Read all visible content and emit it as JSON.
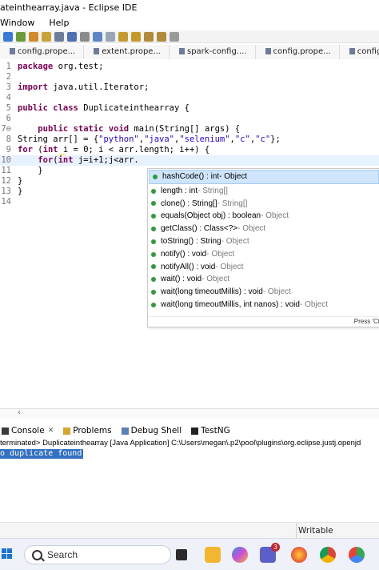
{
  "window": {
    "title": "ateinthearray.java - Eclipse IDE"
  },
  "menu": [
    "Window",
    "Help"
  ],
  "editor_tabs": [
    "config.prope...",
    "extent.prope...",
    "spark-config....",
    "config.prope...",
    "config.prope..."
  ],
  "code_lines": [
    {
      "num": "1",
      "segments": [
        {
          "t": "package",
          "c": "kw"
        },
        {
          "t": " org.test;",
          "c": ""
        }
      ]
    },
    {
      "num": "2",
      "segments": []
    },
    {
      "num": "3",
      "segments": [
        {
          "t": "import",
          "c": "kw"
        },
        {
          "t": " java.util.Iterator;",
          "c": ""
        }
      ]
    },
    {
      "num": "4",
      "segments": []
    },
    {
      "num": "5",
      "segments": [
        {
          "t": "public",
          "c": "kw"
        },
        {
          "t": " ",
          "c": ""
        },
        {
          "t": "class",
          "c": "kw"
        },
        {
          "t": " Duplicateinthearray {",
          "c": ""
        }
      ]
    },
    {
      "num": "6",
      "segments": []
    },
    {
      "num": "7⊖",
      "segments": [
        {
          "t": "    ",
          "c": ""
        },
        {
          "t": "public",
          "c": "kw"
        },
        {
          "t": " ",
          "c": ""
        },
        {
          "t": "static",
          "c": "kw"
        },
        {
          "t": " ",
          "c": ""
        },
        {
          "t": "void",
          "c": "kw"
        },
        {
          "t": " main(String[] args) {",
          "c": ""
        }
      ]
    },
    {
      "num": "8",
      "segments": [
        {
          "t": "String arr[] = {",
          "c": ""
        },
        {
          "t": "\"python\"",
          "c": "str"
        },
        {
          "t": ",",
          "c": ""
        },
        {
          "t": "\"java\"",
          "c": "str"
        },
        {
          "t": ",",
          "c": ""
        },
        {
          "t": "\"selenium\"",
          "c": "str"
        },
        {
          "t": ",",
          "c": ""
        },
        {
          "t": "\"c\"",
          "c": "str"
        },
        {
          "t": ",",
          "c": ""
        },
        {
          "t": "\"c\"",
          "c": "str"
        },
        {
          "t": "};",
          "c": ""
        }
      ]
    },
    {
      "num": "9",
      "segments": [
        {
          "t": "for",
          "c": "kw"
        },
        {
          "t": " (",
          "c": ""
        },
        {
          "t": "int",
          "c": "kw"
        },
        {
          "t": " i = 0; i < arr.length; i++) {",
          "c": ""
        }
      ]
    },
    {
      "num": "10",
      "segments": [
        {
          "t": "    ",
          "c": ""
        },
        {
          "t": "for",
          "c": "kw"
        },
        {
          "t": "(",
          "c": ""
        },
        {
          "t": "int",
          "c": "kw"
        },
        {
          "t": " j=i+1;j<arr.",
          "c": ""
        }
      ]
    },
    {
      "num": "11",
      "segments": [
        {
          "t": "    }",
          "c": ""
        }
      ]
    },
    {
      "num": "12",
      "segments": [
        {
          "t": "}",
          "c": ""
        }
      ]
    },
    {
      "num": "13",
      "segments": [
        {
          "t": "}",
          "c": ""
        }
      ]
    },
    {
      "num": "14",
      "segments": []
    }
  ],
  "autocomplete": {
    "items": [
      {
        "sig": "hashCode() : int",
        "type": " - Object"
      },
      {
        "sig": "length : int",
        "type": " - String[]"
      },
      {
        "sig": "clone() : String[]",
        "type": " - String[]"
      },
      {
        "sig": "equals(Object obj) : boolean",
        "type": " - Object"
      },
      {
        "sig": "getClass() : Class<?>",
        "type": " - Object"
      },
      {
        "sig": "toString() : String",
        "type": " - Object"
      },
      {
        "sig": "notify() : void",
        "type": " - Object"
      },
      {
        "sig": "notifyAll() : void",
        "type": " - Object"
      },
      {
        "sig": "wait() : void",
        "type": " - Object"
      },
      {
        "sig": "wait(long timeoutMillis) : void",
        "type": " - Object"
      },
      {
        "sig": "wait(long timeoutMillis, int nanos) : void",
        "type": " - Object"
      }
    ],
    "footer": "Press 'Ct"
  },
  "console_tabs": [
    {
      "label": "Console",
      "icon": "console-icon"
    },
    {
      "label": "Problems",
      "icon": "problems-icon"
    },
    {
      "label": "Debug Shell",
      "icon": "debug-shell-icon"
    },
    {
      "label": "TestNG",
      "icon": "testng-icon"
    }
  ],
  "console": {
    "status": "terminated> Duplicateinthearray [Java Application] C:\\Users\\megan\\.p2\\pool\\plugins\\org.eclipse.justj.openjd",
    "output": "o duplicate found"
  },
  "statusbar": {
    "mode": "Writable"
  },
  "taskbar": {
    "search_label": "Search",
    "teams_badge": "3"
  },
  "colors": {
    "keyword": "#7f0055",
    "string": "#2a00ff",
    "selection": "#cfe5fb",
    "console_highlight": "#3471c4"
  }
}
